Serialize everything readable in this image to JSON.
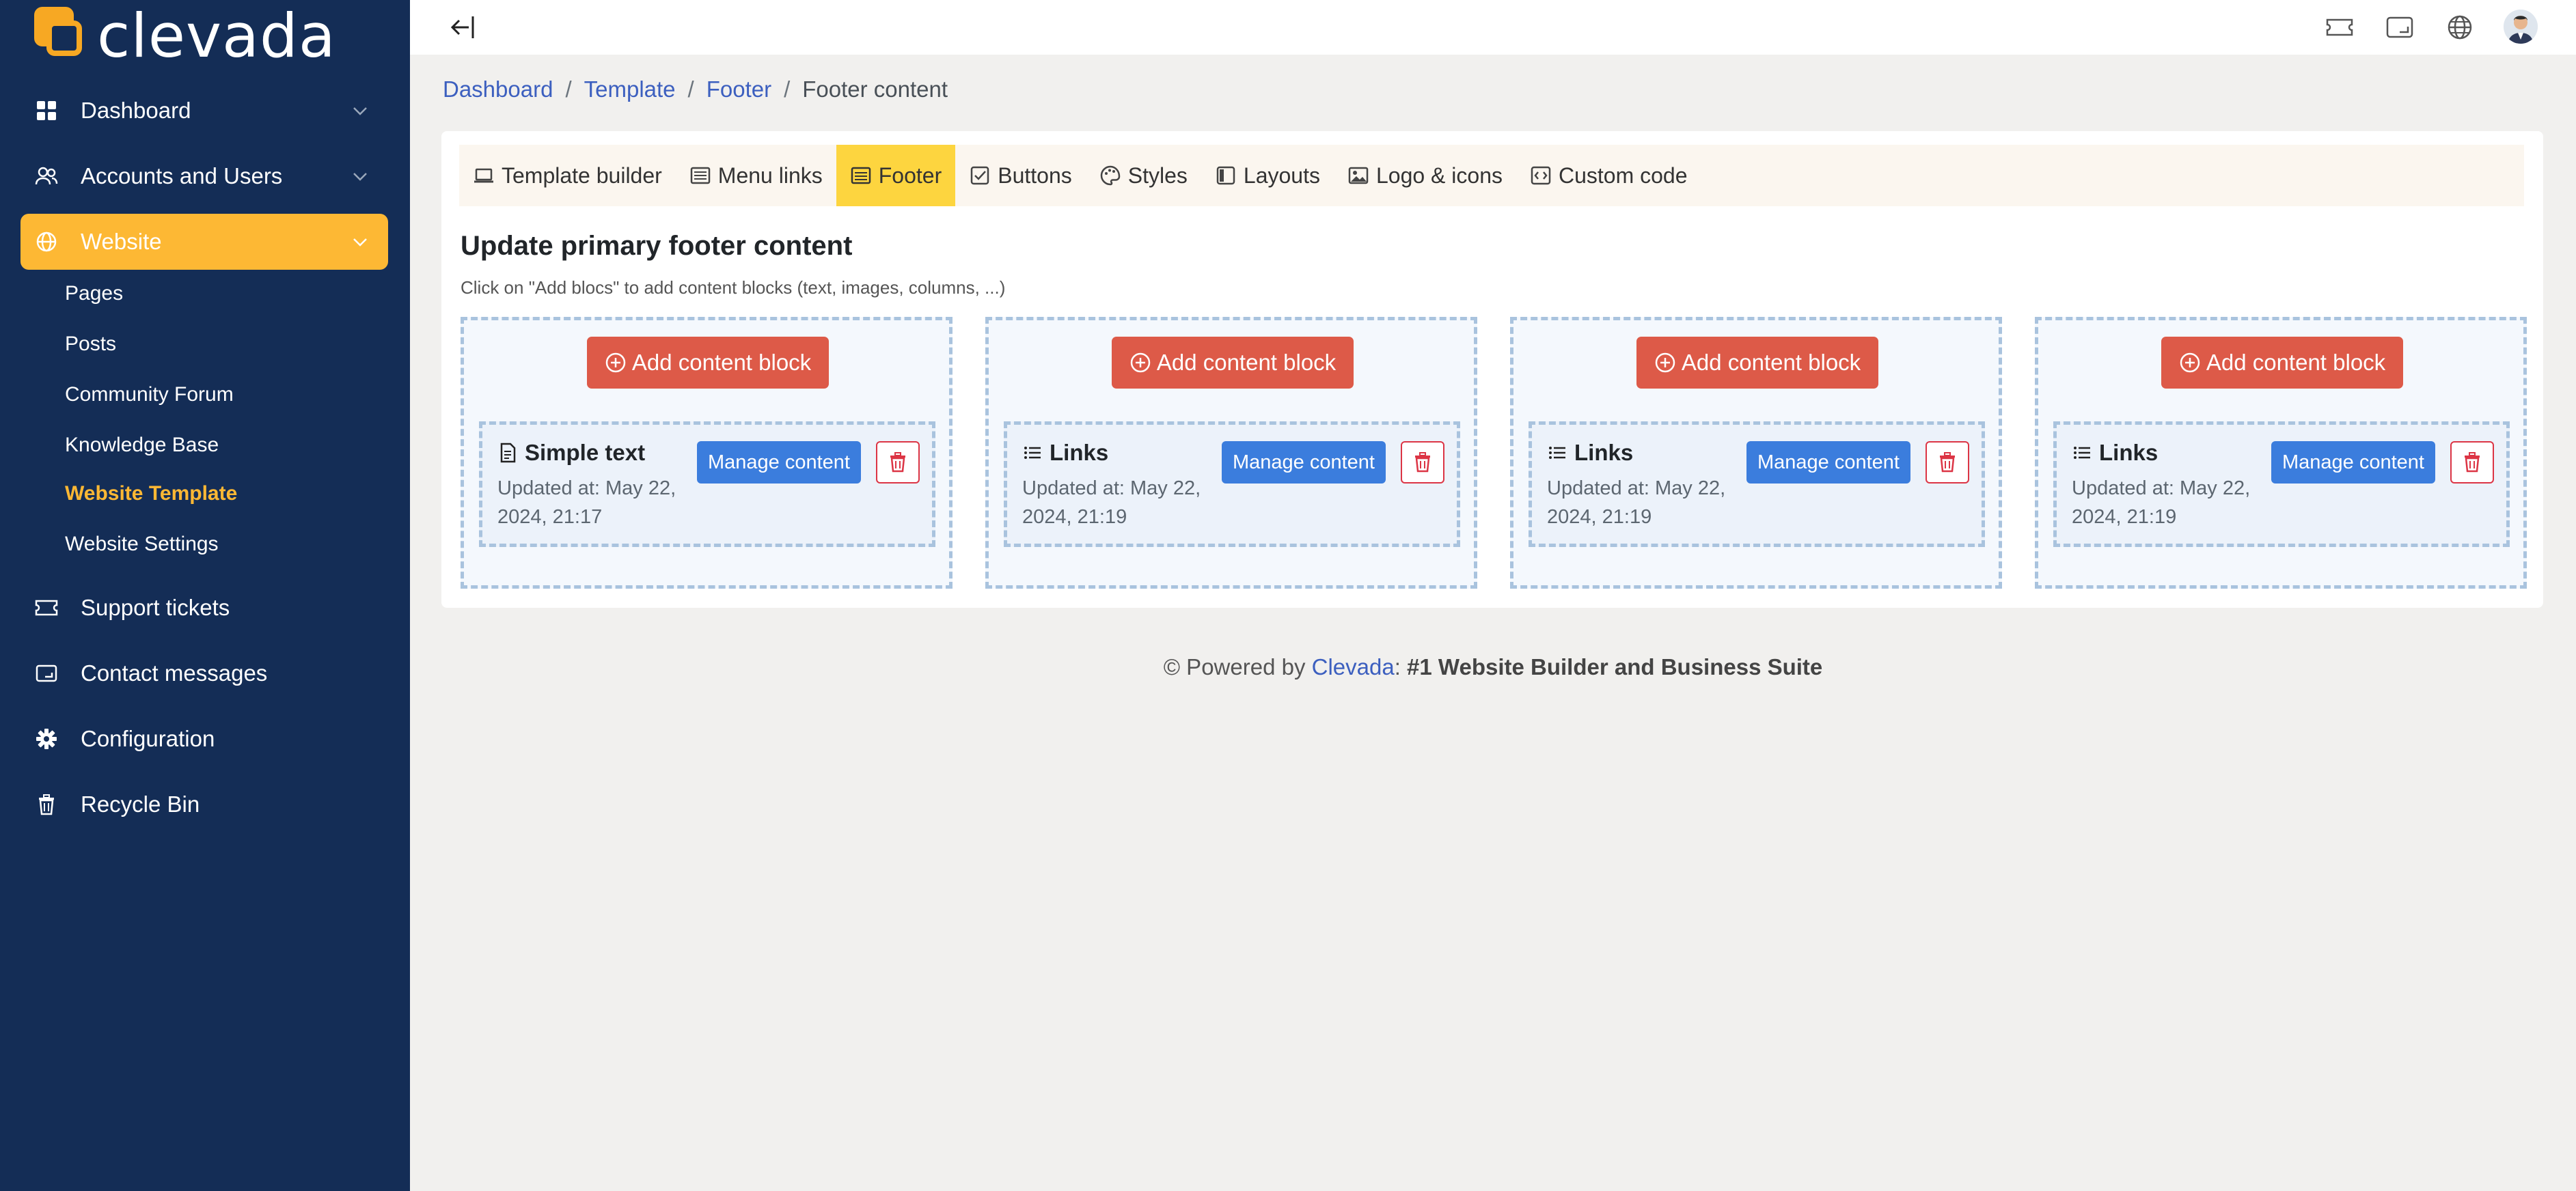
{
  "app": {
    "logo_text": "clevada"
  },
  "sidebar": {
    "items": [
      {
        "label": "Dashboard",
        "icon": "grid-icon"
      },
      {
        "label": "Accounts and Users",
        "icon": "users-icon"
      },
      {
        "label": "Website",
        "icon": "globe-icon",
        "active": true
      },
      {
        "label": "Support tickets",
        "icon": "ticket-icon"
      },
      {
        "label": "Contact messages",
        "icon": "message-icon"
      },
      {
        "label": "Configuration",
        "icon": "gear-icon"
      },
      {
        "label": "Recycle Bin",
        "icon": "trash-icon"
      }
    ],
    "website_sub": [
      "Pages",
      "Posts",
      "Community Forum",
      "Knowledge Base",
      "Website Template",
      "Website Settings"
    ],
    "current_sub": "Website Template"
  },
  "topbar": {
    "icons": [
      "ticket-icon",
      "message-icon",
      "globe-icon",
      "avatar"
    ]
  },
  "breadcrumb": {
    "items": [
      "Dashboard",
      "Template",
      "Footer"
    ],
    "separator": "/",
    "current": "Footer content"
  },
  "tabs": [
    {
      "label": "Template builder",
      "icon": "laptop-icon"
    },
    {
      "label": "Menu links",
      "icon": "menu-icon"
    },
    {
      "label": "Footer",
      "icon": "footer-icon",
      "active": true
    },
    {
      "label": "Buttons",
      "icon": "check-square-icon"
    },
    {
      "label": "Styles",
      "icon": "palette-icon"
    },
    {
      "label": "Layouts",
      "icon": "layout-icon"
    },
    {
      "label": "Logo & icons",
      "icon": "image-icon"
    },
    {
      "label": "Custom code",
      "icon": "code-icon"
    }
  ],
  "main": {
    "title": "Update primary footer content",
    "hint": "Click on \"Add blocs\" to add content blocks (text, images, columns, ...)"
  },
  "columns": [
    {
      "add_label": "Add content block",
      "block": {
        "title": "Simple text",
        "icon": "file-text-icon",
        "updated": "Updated at: May 22, 2024, 21:17",
        "manage_label": "Manage content"
      }
    },
    {
      "add_label": "Add content block",
      "block": {
        "title": "Links",
        "icon": "list-icon",
        "updated": "Updated at: May 22, 2024, 21:19",
        "manage_label": "Manage content"
      }
    },
    {
      "add_label": "Add content block",
      "block": {
        "title": "Links",
        "icon": "list-icon",
        "updated": "Updated at: May 22, 2024, 21:19",
        "manage_label": "Manage content"
      }
    },
    {
      "add_label": "Add content block",
      "block": {
        "title": "Links",
        "icon": "list-icon",
        "updated": "Updated at: May 22, 2024, 21:19",
        "manage_label": "Manage content"
      }
    }
  ],
  "footer": {
    "prefix": "© Powered by",
    "brand": "Clevada",
    "colon": ":",
    "tagline": "#1 Website Builder and Business Suite"
  },
  "colors": {
    "sidebar_bg": "#142d56",
    "accent": "#fdb834",
    "add_button": "#dd5a48",
    "manage_button": "#3b7ddd",
    "delete_border": "#dc3545",
    "link": "#3c5fbf"
  }
}
